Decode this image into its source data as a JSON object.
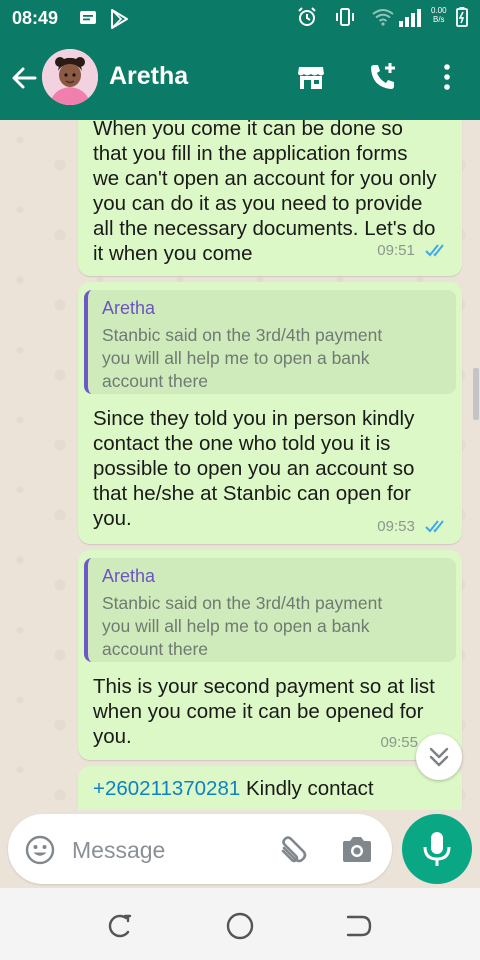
{
  "status_bar": {
    "time": "08:49",
    "net_speed_value": "0.00",
    "net_speed_unit": "B/s"
  },
  "header": {
    "contact_name": "Aretha"
  },
  "messages": [
    {
      "lines": [
        "When you come it can be done  so",
        "that you fill in the application forms",
        "we can't open an account for you only",
        "you can do it as you need to provide",
        "all the necessary documents. Let's do",
        "it when you come"
      ],
      "time": "09:51"
    },
    {
      "quote_name": "Aretha",
      "quote_lines": [
        "Stanbic said on the 3rd/4th payment",
        "you will all help me to open a bank",
        "account there"
      ],
      "lines": [
        "Since they told you in person kindly",
        "contact the one who told you it is",
        "possible to open you an account so",
        "that he/she at Stanbic can open for",
        "you."
      ],
      "time": "09:53"
    },
    {
      "quote_name": "Aretha",
      "quote_lines": [
        "Stanbic said on the 3rd/4th payment",
        "you will all help me to open a bank",
        "account there"
      ],
      "lines": [
        "This is your second payment so at list",
        "when you come it can be opened for",
        "you."
      ],
      "time": "09:55"
    },
    {
      "phone": "+260211370281",
      "text": " Kindly contact"
    }
  ],
  "composer": {
    "placeholder": "Message"
  },
  "colors": {
    "header": "#0b7a66",
    "bubble": "#dcf8c6",
    "accent": "#0aa784",
    "read_ticks": "#3fa9e8",
    "quote_bar": "#6d58c7"
  }
}
